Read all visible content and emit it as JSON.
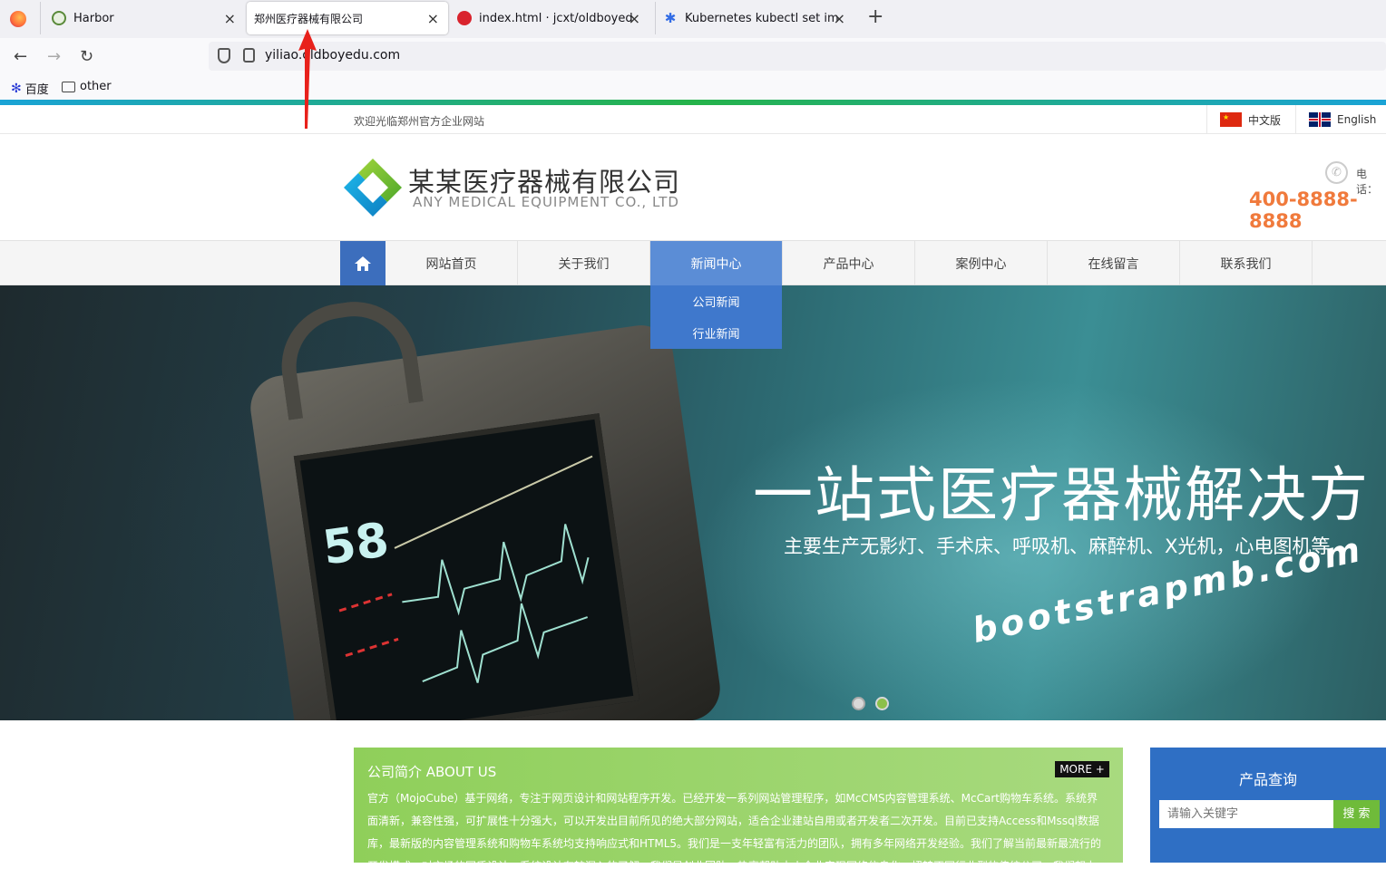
{
  "browser": {
    "tabs": [
      {
        "title": "Harbor"
      },
      {
        "title": "郑州医疗器械有限公司"
      },
      {
        "title": "index.html · jcxt/oldboyedu-l"
      },
      {
        "title": "Kubernetes kubectl set image"
      }
    ],
    "new_tab_symbol": "+",
    "close_symbol": "×",
    "url": "yiliao.oldboyedu.com",
    "bookmarks": [
      {
        "label": "百度"
      },
      {
        "label": "other"
      }
    ]
  },
  "site": {
    "welcome": "欢迎光临郑州官方企业网站",
    "languages": [
      {
        "label": "中文版"
      },
      {
        "label": "English"
      }
    ],
    "company_name": "某某医疗器械有限公司",
    "company_name_en": "ANY MEDICAL EQUIPMENT CO., LTD",
    "phone_label": "电话：",
    "phone": "400-8888-8888",
    "nav": [
      {
        "label": "网站首页"
      },
      {
        "label": "关于我们"
      },
      {
        "label": "新闻中心"
      },
      {
        "label": "产品中心"
      },
      {
        "label": "案例中心"
      },
      {
        "label": "在线留言"
      },
      {
        "label": "联系我们"
      }
    ],
    "dropdown": [
      {
        "label": "公司新闻"
      },
      {
        "label": "行业新闻"
      }
    ],
    "banner": {
      "headline": "一站式医疗器械解决方",
      "subline": "主要生产无影灯、手术床、呼吸机、麻醉机、X光机，心电图机等",
      "watermark": "bootstrapmb.com",
      "monitor_reading": "58"
    },
    "about": {
      "title": "公司简介 ABOUT US",
      "more": "MORE +",
      "text": "官方（MojoCube）基于网络，专注于网页设计和网站程序开发。已经开发一系列网站管理程序，如McCMS内容管理系统、McCart购物车系统。系统界面清新，兼容性强，可扩展性十分强大，可以开发出目前所见的绝大部分网站，适合企业建站自用或者开发者二次开发。目前已支持Access和Mssql数据库，最新版的内容管理系统和购物车系统均支持响应式和HTML5。我们是一支年轻富有活力的团队，拥有多年网络开发经验。我们了解当前最新最流行的开发模式，对市场的同质设计、系统设计有较深入的了解，我们是创业团队，热衷帮助中小企业实现网络信息化，扭转不同行业型的传统公司，我们努力"
    },
    "search": {
      "title": "产品查询",
      "placeholder": "请输入关键字",
      "button": "搜 索"
    }
  }
}
